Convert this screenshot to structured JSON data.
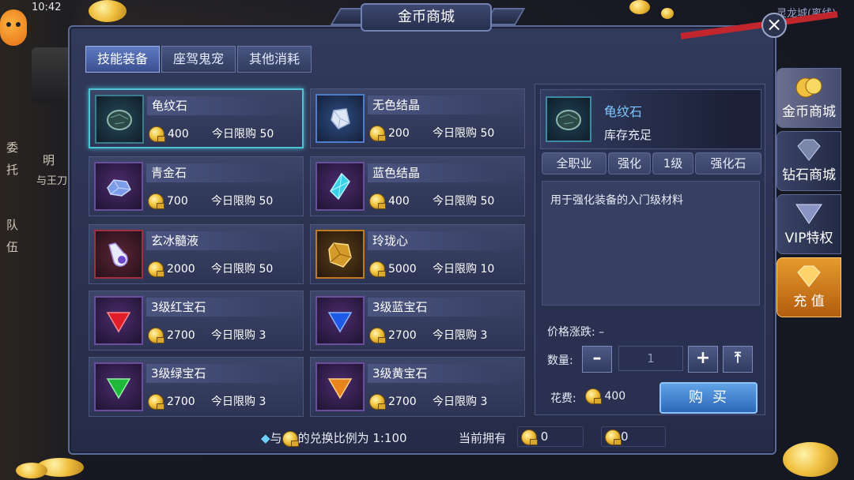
{
  "status": {
    "time": "10:42"
  },
  "window": {
    "title": "金币商城",
    "close_label": "×"
  },
  "tabs": [
    {
      "label": "技能装备",
      "active": true
    },
    {
      "label": "座驾鬼宠",
      "active": false
    },
    {
      "label": "其他消耗",
      "active": false
    }
  ],
  "items": [
    {
      "name": "龟纹石",
      "price": "400",
      "limit": "今日限购 50",
      "icon": "dark-stone-icon",
      "selected": true
    },
    {
      "name": "无色结晶",
      "price": "200",
      "limit": "今日限购 50",
      "icon": "white-crystal-icon"
    },
    {
      "name": "青金石",
      "price": "700",
      "limit": "今日限购 50",
      "icon": "lapis-stone-icon"
    },
    {
      "name": "蓝色结晶",
      "price": "400",
      "limit": "今日限购 50",
      "icon": "blue-crystal-icon"
    },
    {
      "name": "玄冰髓液",
      "price": "2000",
      "limit": "今日限购 50",
      "icon": "potion-flask-icon"
    },
    {
      "name": "玲珑心",
      "price": "5000",
      "limit": "今日限购 10",
      "icon": "amber-heart-icon"
    },
    {
      "name": "3级红宝石",
      "price": "2700",
      "limit": "今日限购 3",
      "icon": "red-gem-icon"
    },
    {
      "name": "3级蓝宝石",
      "price": "2700",
      "limit": "今日限购 3",
      "icon": "blue-gem-icon"
    },
    {
      "name": "3级绿宝石",
      "price": "2700",
      "limit": "今日限购 3",
      "icon": "green-gem-icon"
    },
    {
      "name": "3级黄宝石",
      "price": "2700",
      "limit": "今日限购 3",
      "icon": "yellow-gem-icon"
    }
  ],
  "detail": {
    "name": "龟纹石",
    "stock": "库存充足",
    "tags": [
      "全职业",
      "强化",
      "1级",
      "强化石"
    ],
    "description": "用于强化装备的入门级材料",
    "price_change_label": "价格涨跌: –",
    "quantity_label": "数量:",
    "quantity": "1",
    "cost_label": "花费:",
    "cost": "400",
    "buy_label": "购买"
  },
  "footer": {
    "rate_prefix": "与",
    "rate_text": "的兑换比例为 1:100",
    "owned_label": "当前拥有",
    "owned_coins": "0",
    "owned_bound": "0"
  },
  "side_nav": [
    {
      "label": "金币商城",
      "active": true
    },
    {
      "label": "钻石商城"
    },
    {
      "label": "VIP特权"
    },
    {
      "label": "充 值"
    }
  ],
  "background_text": {
    "left_a": "委",
    "left_b": "托",
    "left_c": "队",
    "left_d": "伍",
    "left_e": "与王刀",
    "left_f": "明",
    "top_right": "灵龙城(离线)"
  },
  "colors": {
    "accent": "#4fc3d6",
    "detail_name": "#7fc8ff",
    "buy": "#2d67b8"
  }
}
